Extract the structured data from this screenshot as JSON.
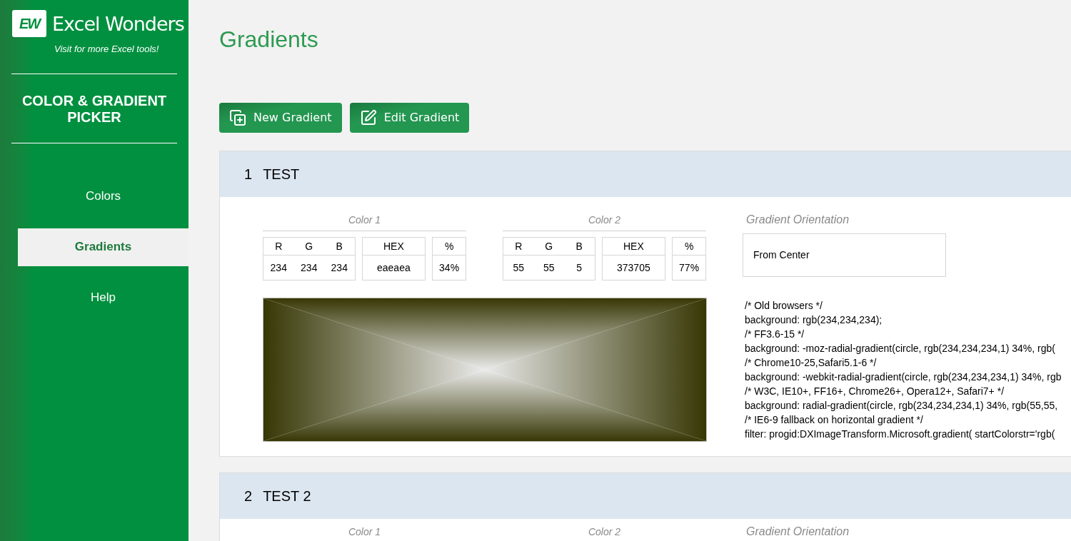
{
  "brand": {
    "mark": "EW",
    "name": "Excel Wonders",
    "tagline": "Visit for more Excel tools!"
  },
  "app_title": "COLOR & GRADIENT PICKER",
  "nav": [
    {
      "label": "Colors",
      "selected": false
    },
    {
      "label": "Gradients",
      "selected": true
    },
    {
      "label": "Help",
      "selected": false
    }
  ],
  "page_title": "Gradients",
  "toolbar": [
    {
      "kind": "new",
      "label": "New Gradient"
    },
    {
      "kind": "edit",
      "label": "Edit Gradient"
    }
  ],
  "gradients": [
    {
      "index": "1",
      "name": "TEST",
      "colors": [
        {
          "label": "Color 1",
          "headers": [
            "R",
            "G",
            "B",
            "HEX",
            "%"
          ],
          "values": [
            "234",
            "234",
            "234",
            "eaeaea",
            "34%"
          ],
          "color": "#eaeaea"
        },
        {
          "label": "Color 2",
          "headers": [
            "R",
            "G",
            "B",
            "HEX",
            "%"
          ],
          "values": [
            "55",
            "55",
            "5",
            "373705",
            "77%"
          ],
          "color": "#373705"
        }
      ],
      "orientation_label": "Gradient Orientation",
      "orientation": "From Center",
      "css_lines": [
        "/* Old browsers */",
        "background: rgb(234,234,234);",
        "/* FF3.6-15 */",
        "background: -moz-radial-gradient(circle, rgb(234,234,234,1) 34%, rgb(",
        "/* Chrome10-25,Safari5.1-6 */",
        "background: -webkit-radial-gradient(circle, rgb(234,234,234,1) 34%, rgb",
        "/* W3C, IE10+, FF16+, Chrome26+, Opera12+, Safari7+ */",
        "background: radial-gradient(circle, rgb(234,234,234,1) 34%, rgb(55,55,",
        "/* IE6-9 fallback on horizontal gradient */",
        "filter: progid:DXImageTransform.Microsoft.gradient( startColorstr='rgb("
      ]
    },
    {
      "index": "2",
      "name": "TEST 2",
      "colors": [
        {
          "label": "Color 1"
        },
        {
          "label": "Color 2"
        }
      ],
      "orientation_label": "Gradient Orientation"
    }
  ]
}
